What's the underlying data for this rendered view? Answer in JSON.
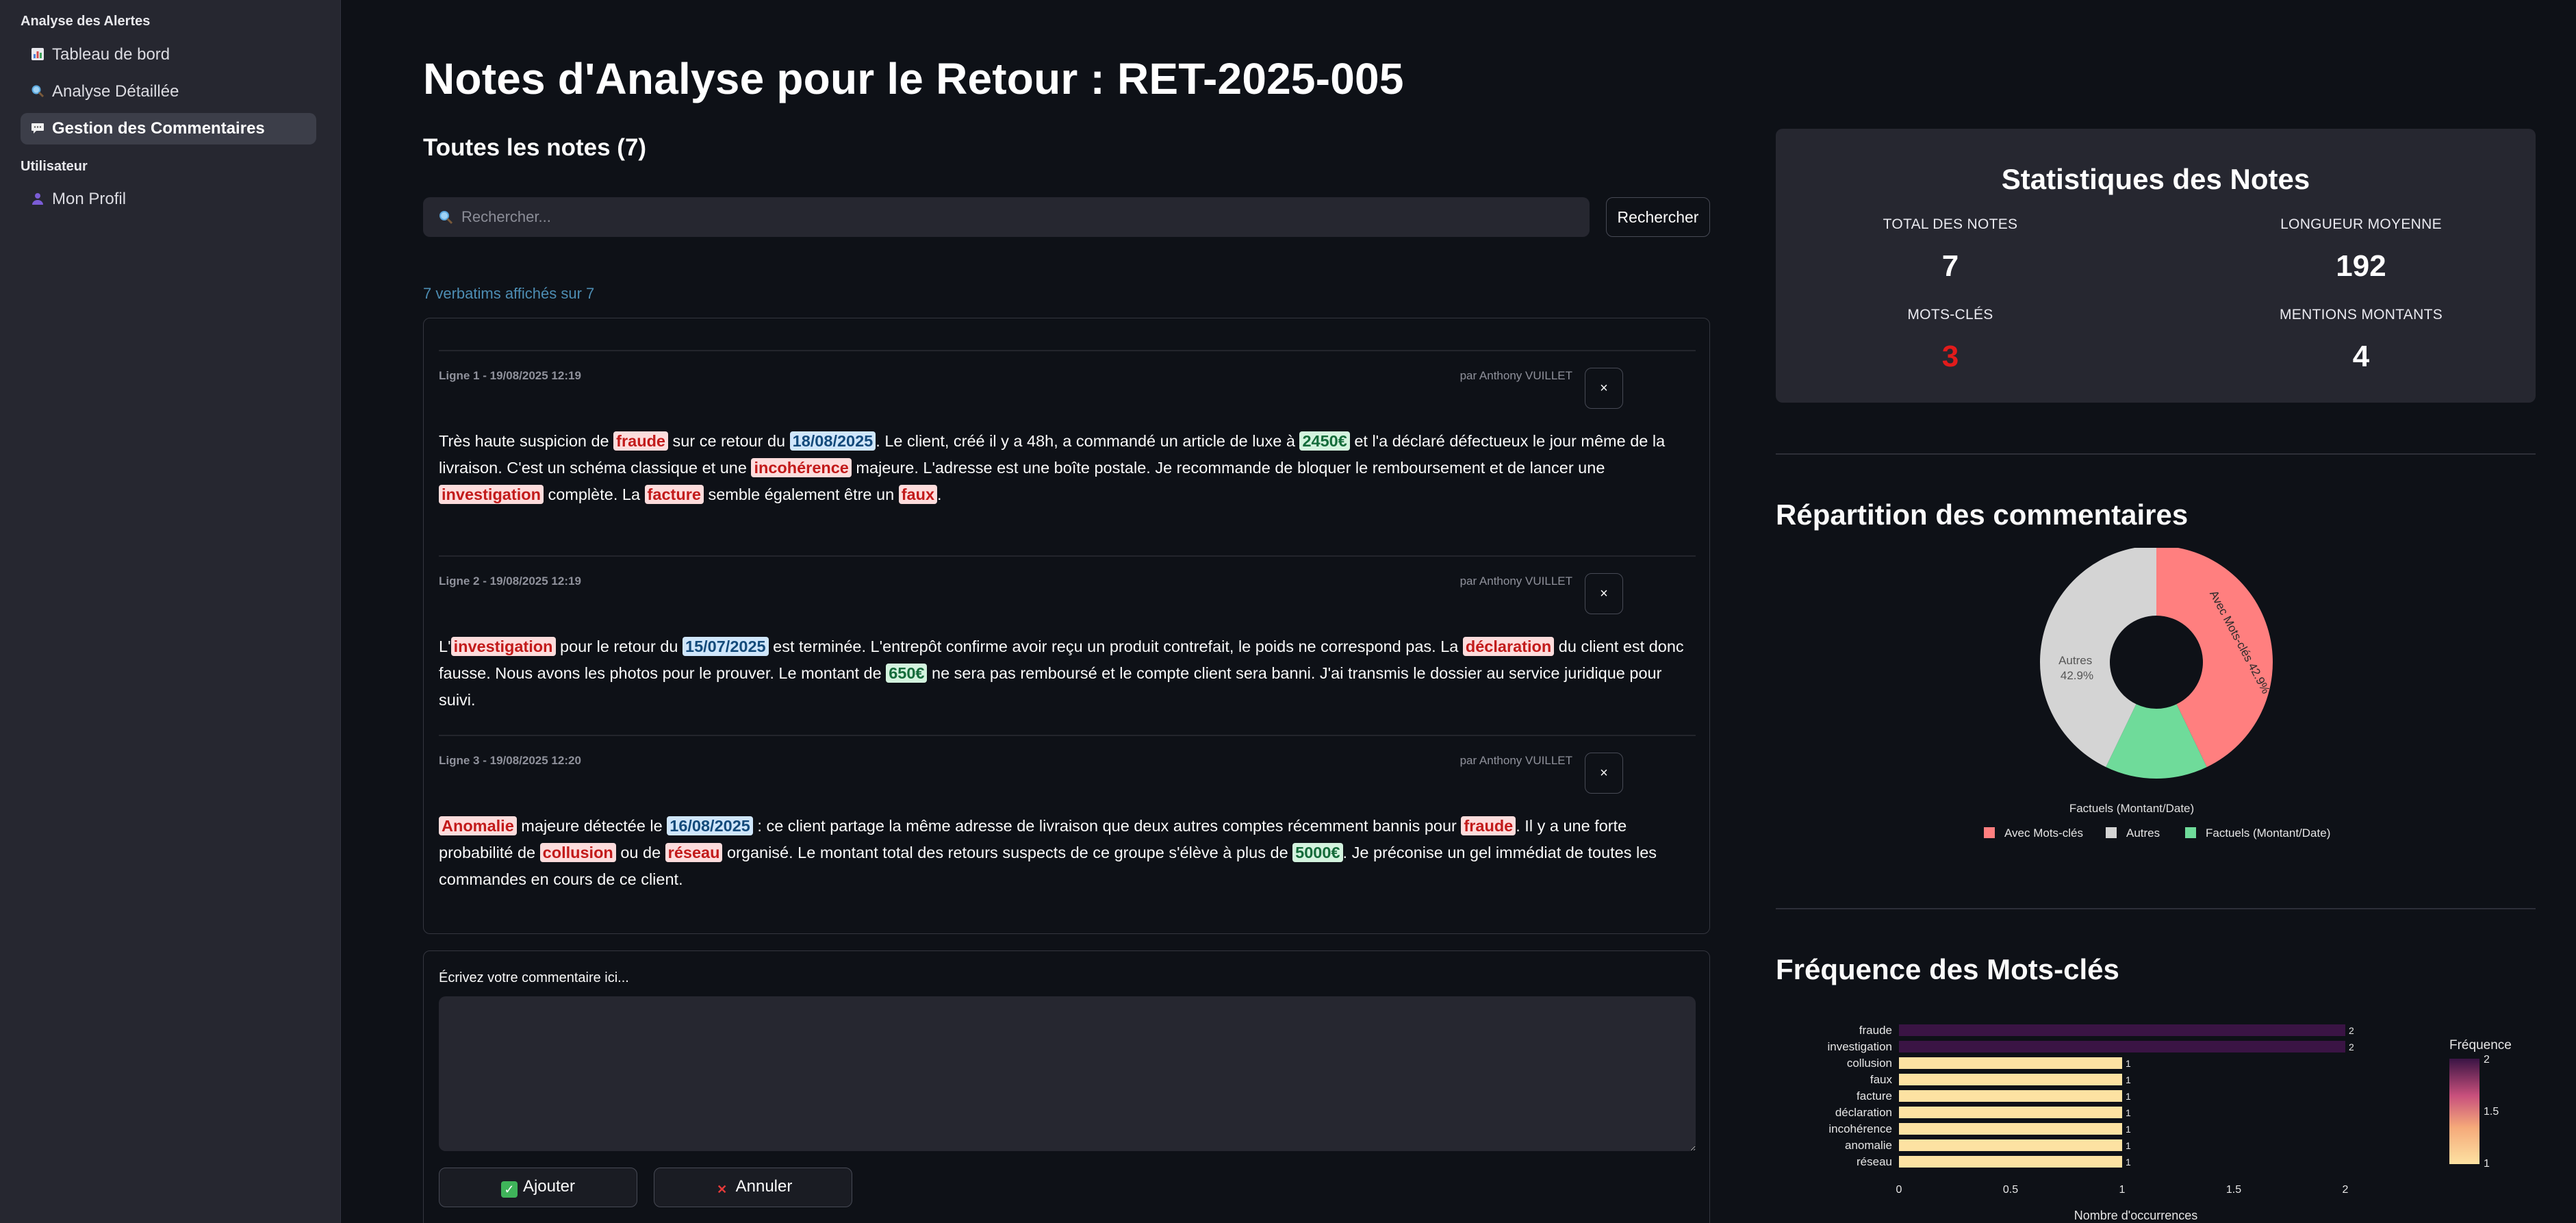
{
  "sidebar": {
    "section_alerts": "Analyse des Alertes",
    "section_user": "Utilisateur",
    "items": [
      {
        "label": "Tableau de bord",
        "icon": "chart-icon"
      },
      {
        "label": "Analyse Détaillée",
        "icon": "magnifier-icon"
      },
      {
        "label": "Gestion des Commentaires",
        "icon": "speech-bubble-icon",
        "active": true
      },
      {
        "label": "Mon Profil",
        "icon": "user-icon"
      }
    ]
  },
  "main": {
    "title": "Notes d'Analyse pour le Retour : RET-2025-005",
    "subtitle": "Toutes les notes (7)",
    "search_placeholder": "Rechercher...",
    "search_button": "Rechercher",
    "count_text": "7 verbatims affichés sur 7",
    "notes": [
      {
        "meta": "Ligne 1 - 19/08/2025 12:19",
        "author": "par Anthony VUILLET",
        "close": "×",
        "segments": [
          {
            "t": "Très haute suspicion de "
          },
          {
            "t": "fraude",
            "k": "red"
          },
          {
            "t": " sur ce retour du "
          },
          {
            "t": "18/08/2025",
            "k": "blue"
          },
          {
            "t": ". Le client, créé il y a 48h, a commandé un article de luxe à "
          },
          {
            "t": "2450€",
            "k": "green"
          },
          {
            "t": " et l'a déclaré défectueux le jour même de la livraison. C'est un schéma classique et une "
          },
          {
            "t": "incohérence",
            "k": "red"
          },
          {
            "t": " majeure. L'adresse est une boîte postale. Je recommande de bloquer le remboursement et de lancer une "
          },
          {
            "t": "investigation",
            "k": "red"
          },
          {
            "t": " complète. La "
          },
          {
            "t": "facture",
            "k": "red"
          },
          {
            "t": " semble également être un "
          },
          {
            "t": "faux",
            "k": "red"
          },
          {
            "t": "."
          }
        ]
      },
      {
        "meta": "Ligne 2 - 19/08/2025 12:19",
        "author": "par Anthony VUILLET",
        "close": "×",
        "segments": [
          {
            "t": "L'"
          },
          {
            "t": "investigation",
            "k": "red"
          },
          {
            "t": " pour le retour du "
          },
          {
            "t": "15/07/2025",
            "k": "blue"
          },
          {
            "t": " est terminée. L'entrepôt confirme avoir reçu un produit contrefait, le poids ne correspond pas. La "
          },
          {
            "t": "déclaration",
            "k": "red"
          },
          {
            "t": " du client est donc fausse. Nous avons les photos pour le prouver. Le montant de "
          },
          {
            "t": "650€",
            "k": "green"
          },
          {
            "t": " ne sera pas remboursé et le compte client sera banni. J'ai transmis le dossier au service juridique pour suivi."
          }
        ]
      },
      {
        "meta": "Ligne 3 - 19/08/2025 12:20",
        "author": "par Anthony VUILLET",
        "close": "×",
        "segments": [
          {
            "t": "Anomalie",
            "k": "red"
          },
          {
            "t": " majeure détectée le "
          },
          {
            "t": "16/08/2025",
            "k": "blue"
          },
          {
            "t": " : ce client partage la même adresse de livraison que deux autres comptes récemment bannis pour "
          },
          {
            "t": "fraude",
            "k": "red"
          },
          {
            "t": ". Il y a une forte probabilité de "
          },
          {
            "t": "collusion",
            "k": "red"
          },
          {
            "t": " ou de "
          },
          {
            "t": "réseau",
            "k": "red"
          },
          {
            "t": " organisé. Le montant total des retours suspects de ce groupe s'élève à plus de "
          },
          {
            "t": "5000€",
            "k": "green"
          },
          {
            "t": ". Je préconise un gel immédiat de toutes les commandes en cours de ce client."
          }
        ]
      }
    ],
    "comment_label": "Écrivez votre commentaire ici...",
    "add_button": "Ajouter",
    "cancel_button": "Annuler"
  },
  "stats": {
    "title": "Statistiques des Notes",
    "items": [
      {
        "label": "TOTAL DES NOTES",
        "value": "7"
      },
      {
        "label": "LONGUEUR MOYENNE",
        "value": "192"
      },
      {
        "label": "MOTS-CLÉS",
        "value": "3"
      },
      {
        "label": "MENTIONS MONTANTS",
        "value": "4"
      }
    ]
  },
  "colors": {
    "keyword_red": "#c21a1a",
    "date_blue": "#134a7a",
    "amount_green": "#146b3a",
    "stat_red": "#e21b1b",
    "pie_keywords": "#ff7f7f",
    "pie_others": "#d4d4d4",
    "pie_factual": "#6fdb9a"
  },
  "chart_data": [
    {
      "type": "pie",
      "title": "Répartition des commentaires",
      "labels": [
        "Avec Mots-clés",
        "Autres",
        "Factuels (Montant/Date)"
      ],
      "values": [
        42.9,
        42.9,
        14.3
      ],
      "slice_labels": [
        "Avec Mots-clés 42.9%",
        "Autres 42.9%",
        "Factuels (Montant/Date)"
      ],
      "hole": true,
      "legend": "bottom"
    },
    {
      "type": "bar",
      "orientation": "horizontal",
      "title": "Fréquence des Mots-clés",
      "categories": [
        "fraude",
        "investigation",
        "collusion",
        "faux",
        "facture",
        "déclaration",
        "incohérence",
        "anomalie",
        "réseau"
      ],
      "values": [
        2,
        2,
        1,
        1,
        1,
        1,
        1,
        1,
        1
      ],
      "xlabel": "Nombre d'occurrences",
      "xticks": [
        "0",
        "0.5",
        "1",
        "1.5",
        "2"
      ],
      "xlim": [
        0,
        2
      ],
      "colorbar": {
        "title": "Fréquence",
        "ticks": [
          "2",
          "1.5",
          "1"
        ],
        "range": [
          1,
          2
        ]
      }
    }
  ]
}
